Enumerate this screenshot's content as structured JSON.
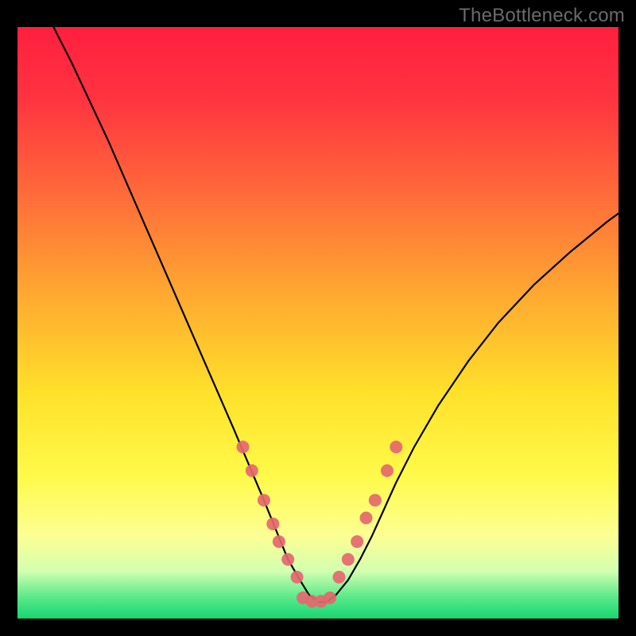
{
  "watermark": "TheBottleneck.com",
  "chart_data": {
    "type": "line",
    "title": "",
    "xlabel": "",
    "ylabel": "",
    "xlim": [
      0,
      100
    ],
    "ylim": [
      0,
      100
    ],
    "grid": false,
    "background": {
      "type": "vertical_gradient",
      "stops": [
        {
          "pos": 0.0,
          "color": "#ff1f3f"
        },
        {
          "pos": 0.12,
          "color": "#ff3340"
        },
        {
          "pos": 0.28,
          "color": "#ff6a3a"
        },
        {
          "pos": 0.45,
          "color": "#ffa831"
        },
        {
          "pos": 0.62,
          "color": "#ffe12a"
        },
        {
          "pos": 0.76,
          "color": "#fffa4a"
        },
        {
          "pos": 0.86,
          "color": "#fcff93"
        },
        {
          "pos": 0.92,
          "color": "#d2ffb0"
        },
        {
          "pos": 0.965,
          "color": "#58e88a"
        },
        {
          "pos": 1.0,
          "color": "#17d66f"
        }
      ]
    },
    "series": [
      {
        "name": "bottleneck_curve",
        "color": "#000000",
        "x": [
          6,
          9,
          12,
          15,
          18,
          21,
          24,
          27,
          30,
          33,
          36,
          38.5,
          41,
          43,
          45,
          47,
          48.5,
          50,
          51.5,
          53,
          55,
          57,
          59,
          61,
          63,
          66,
          70,
          75,
          80,
          86,
          92,
          98,
          100
        ],
        "y": [
          100,
          94,
          87.5,
          81,
          74,
          67,
          60,
          53,
          46,
          39,
          32,
          26,
          20,
          15,
          10,
          6.5,
          4,
          2.8,
          2.8,
          4,
          6.5,
          10,
          14,
          18.5,
          23,
          29,
          36,
          43.5,
          50,
          56.5,
          62,
          67,
          68.5
        ]
      }
    ],
    "markers": [
      {
        "name": "curve_points_left",
        "color": "#e5676f",
        "radius": 8,
        "points": [
          {
            "x": 37.5,
            "y": 29
          },
          {
            "x": 39.0,
            "y": 25
          },
          {
            "x": 41.0,
            "y": 20
          },
          {
            "x": 42.5,
            "y": 16
          },
          {
            "x": 43.5,
            "y": 13
          },
          {
            "x": 45.0,
            "y": 10
          },
          {
            "x": 46.5,
            "y": 7
          }
        ]
      },
      {
        "name": "curve_points_right",
        "color": "#e5676f",
        "radius": 8,
        "points": [
          {
            "x": 53.5,
            "y": 7
          },
          {
            "x": 55.0,
            "y": 10
          },
          {
            "x": 56.5,
            "y": 13
          },
          {
            "x": 58.0,
            "y": 17
          },
          {
            "x": 59.5,
            "y": 20
          },
          {
            "x": 61.5,
            "y": 25
          },
          {
            "x": 63.0,
            "y": 29
          }
        ]
      },
      {
        "name": "curve_points_bottom",
        "color": "#e5676f",
        "radius": 8,
        "points": [
          {
            "x": 47.5,
            "y": 3.5
          },
          {
            "x": 49.0,
            "y": 2.9
          },
          {
            "x": 50.5,
            "y": 2.9
          },
          {
            "x": 52.0,
            "y": 3.5
          }
        ]
      }
    ]
  }
}
